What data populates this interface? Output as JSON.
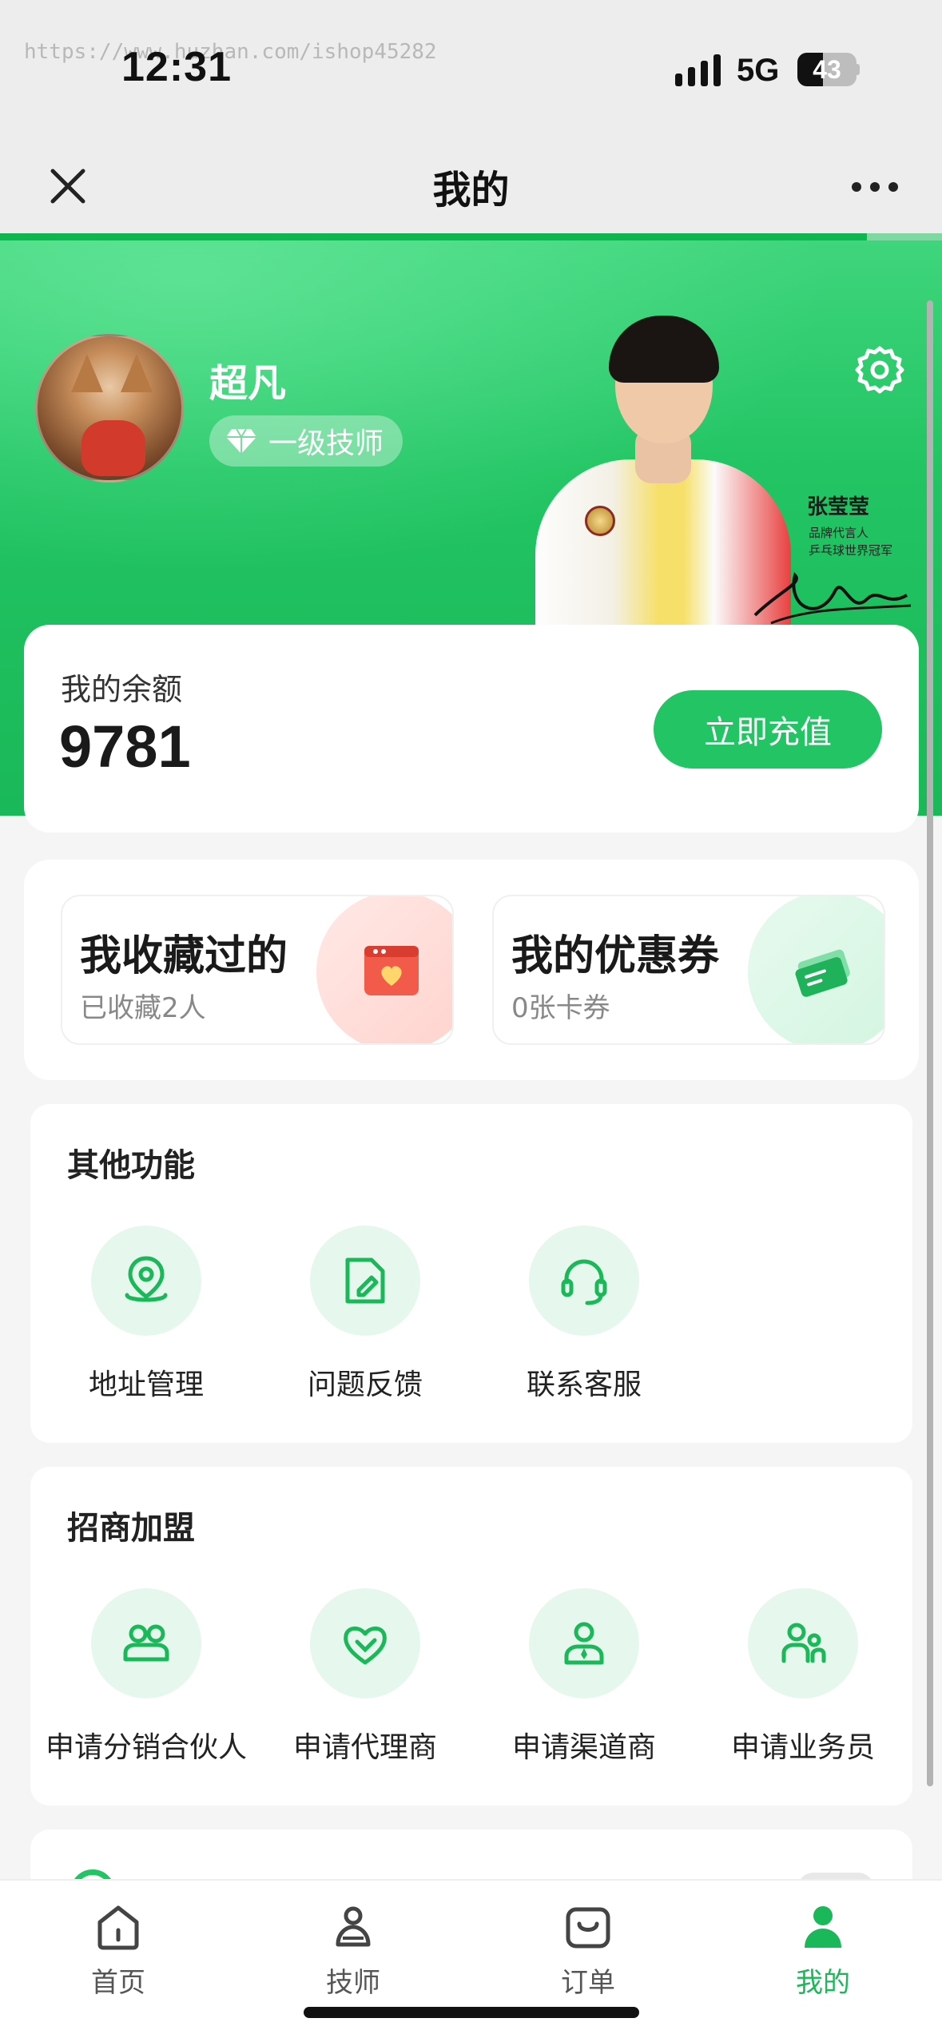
{
  "status_bar": {
    "time": "12:31",
    "watermark": "https://www.huzhan.com/ishop45282",
    "network": "5G",
    "battery_level": "43",
    "battery_fraction": 0.43
  },
  "nav": {
    "title": "我的",
    "close_icon": "close-icon",
    "more_icon": "more-icon",
    "load_progress": 0.92
  },
  "profile": {
    "name": "超凡",
    "level": "一级技师",
    "settings_icon": "gear-icon"
  },
  "spokesperson": {
    "name": "张莹莹",
    "title_line1": "品牌代言人",
    "title_line2": "乒乓球世界冠军"
  },
  "balance": {
    "label": "我的余额",
    "value": "9781",
    "recharge_label": "立即充值"
  },
  "shortcuts": {
    "favorites": {
      "title": "我收藏过的",
      "subtitle": "已收藏2人",
      "icon": "heart-card-icon"
    },
    "coupons": {
      "title": "我的优惠券",
      "subtitle": "0张卡券",
      "icon": "ticket-icon"
    }
  },
  "other_functions": {
    "title": "其他功能",
    "items": [
      {
        "label": "地址管理",
        "icon": "location-pin-icon"
      },
      {
        "label": "问题反馈",
        "icon": "edit-document-icon"
      },
      {
        "label": "联系客服",
        "icon": "headset-icon"
      }
    ]
  },
  "franchise": {
    "title": "招商加盟",
    "items": [
      {
        "label": "申请分销合伙人",
        "icon": "people-icon"
      },
      {
        "label": "申请代理商",
        "icon": "heart-handshake-icon"
      },
      {
        "label": "申请渠道商",
        "icon": "user-tie-icon"
      },
      {
        "label": "申请业务员",
        "icon": "user-group-icon"
      }
    ]
  },
  "tab_bar": {
    "items": [
      {
        "label": "首页",
        "icon": "home-icon",
        "active": false
      },
      {
        "label": "技师",
        "icon": "technician-icon",
        "active": false
      },
      {
        "label": "订单",
        "icon": "order-bag-icon",
        "active": false
      },
      {
        "label": "我的",
        "icon": "profile-icon",
        "active": true
      }
    ]
  },
  "colors": {
    "brand_green": "#22c463",
    "light_green": "#e6f8ed",
    "page_bg": "#f5f5f5"
  }
}
